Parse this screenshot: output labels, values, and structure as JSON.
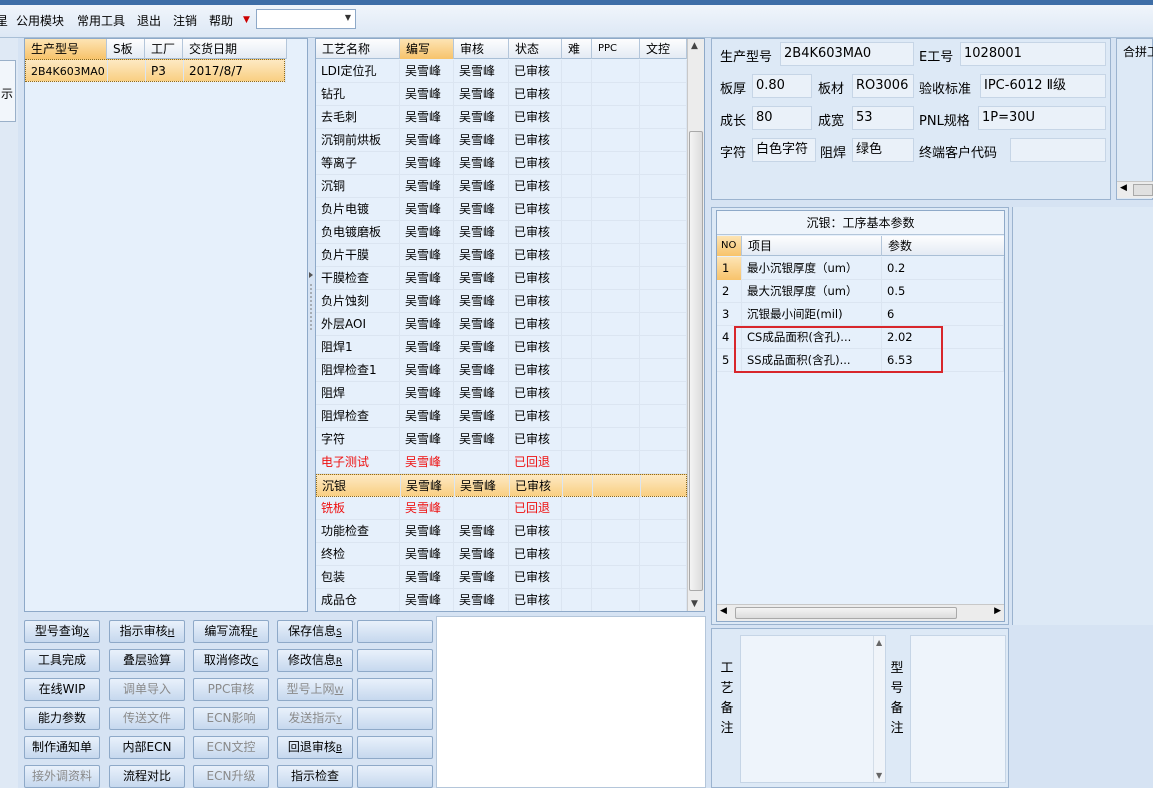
{
  "menu": {
    "items": [
      "星",
      "公用模块",
      "常用工具",
      "退出",
      "注销",
      "帮助"
    ],
    "dropdown_value": ""
  },
  "left_strip": {
    "label": "示"
  },
  "model_grid": {
    "headers": [
      "生产型号",
      "S板",
      "工厂",
      "交货日期"
    ],
    "rows": [
      {
        "model": "2B4K603MA0",
        "s": "",
        "factory": "P3",
        "date": "2017/8/7"
      }
    ]
  },
  "process_grid": {
    "headers": [
      "工艺名称",
      "编写",
      "审核",
      "状态",
      "难",
      "PPC",
      "文控"
    ],
    "rows": [
      {
        "name": "LDI定位孔",
        "writer": "吴雪峰",
        "reviewer": "吴雪峰",
        "status": "已审核",
        "flag": "normal"
      },
      {
        "name": "钻孔",
        "writer": "吴雪峰",
        "reviewer": "吴雪峰",
        "status": "已审核",
        "flag": "normal"
      },
      {
        "name": "去毛刺",
        "writer": "吴雪峰",
        "reviewer": "吴雪峰",
        "status": "已审核",
        "flag": "normal"
      },
      {
        "name": "沉铜前烘板",
        "writer": "吴雪峰",
        "reviewer": "吴雪峰",
        "status": "已审核",
        "flag": "normal"
      },
      {
        "name": "等离子",
        "writer": "吴雪峰",
        "reviewer": "吴雪峰",
        "status": "已审核",
        "flag": "normal"
      },
      {
        "name": "沉铜",
        "writer": "吴雪峰",
        "reviewer": "吴雪峰",
        "status": "已审核",
        "flag": "normal"
      },
      {
        "name": "负片电镀",
        "writer": "吴雪峰",
        "reviewer": "吴雪峰",
        "status": "已审核",
        "flag": "normal"
      },
      {
        "name": "负电镀磨板",
        "writer": "吴雪峰",
        "reviewer": "吴雪峰",
        "status": "已审核",
        "flag": "normal"
      },
      {
        "name": "负片干膜",
        "writer": "吴雪峰",
        "reviewer": "吴雪峰",
        "status": "已审核",
        "flag": "normal"
      },
      {
        "name": "干膜检查",
        "writer": "吴雪峰",
        "reviewer": "吴雪峰",
        "status": "已审核",
        "flag": "normal"
      },
      {
        "name": "负片蚀刻",
        "writer": "吴雪峰",
        "reviewer": "吴雪峰",
        "status": "已审核",
        "flag": "normal"
      },
      {
        "name": "外层AOI",
        "writer": "吴雪峰",
        "reviewer": "吴雪峰",
        "status": "已审核",
        "flag": "normal"
      },
      {
        "name": "阻焊1",
        "writer": "吴雪峰",
        "reviewer": "吴雪峰",
        "status": "已审核",
        "flag": "normal"
      },
      {
        "name": "阻焊检查1",
        "writer": "吴雪峰",
        "reviewer": "吴雪峰",
        "status": "已审核",
        "flag": "normal"
      },
      {
        "name": "阻焊",
        "writer": "吴雪峰",
        "reviewer": "吴雪峰",
        "status": "已审核",
        "flag": "normal"
      },
      {
        "name": "阻焊检查",
        "writer": "吴雪峰",
        "reviewer": "吴雪峰",
        "status": "已审核",
        "flag": "normal"
      },
      {
        "name": "字符",
        "writer": "吴雪峰",
        "reviewer": "吴雪峰",
        "status": "已审核",
        "flag": "normal"
      },
      {
        "name": "电子测试",
        "writer": "吴雪峰",
        "reviewer": "",
        "status": "已回退",
        "flag": "returned"
      },
      {
        "name": "沉银",
        "writer": "吴雪峰",
        "reviewer": "吴雪峰",
        "status": "已审核",
        "flag": "selected"
      },
      {
        "name": "铣板",
        "writer": "吴雪峰",
        "reviewer": "",
        "status": "已回退",
        "flag": "returned"
      },
      {
        "name": "功能检查",
        "writer": "吴雪峰",
        "reviewer": "吴雪峰",
        "status": "已审核",
        "flag": "normal"
      },
      {
        "name": "终检",
        "writer": "吴雪峰",
        "reviewer": "吴雪峰",
        "status": "已审核",
        "flag": "normal"
      },
      {
        "name": "包装",
        "writer": "吴雪峰",
        "reviewer": "吴雪峰",
        "status": "已审核",
        "flag": "normal"
      },
      {
        "name": "成品仓",
        "writer": "吴雪峰",
        "reviewer": "吴雪峰",
        "status": "已审核",
        "flag": "normal"
      }
    ]
  },
  "info": {
    "model_label": "生产型号",
    "model_value": "2B4K603MA0",
    "eno_label": "E工号",
    "eno_value": "1028001",
    "thickness_label": "板厚",
    "thickness_value": "0.80",
    "material_label": "板材",
    "material_value": "RO3006",
    "standard_label": "验收标准",
    "standard_value": "IPC-6012 Ⅱ级",
    "length_label": "成长",
    "length_value": "80",
    "width_label": "成宽",
    "width_value": "53",
    "pnl_label": "PNL规格",
    "pnl_value": "1P=30U",
    "legend_label": "字符",
    "legend_value": "白色字符",
    "mask_label": "阻焊",
    "mask_value": "绿色",
    "customer_label": "终端客户代码",
    "customer_value": ""
  },
  "merge_panel": {
    "title": "合拼工"
  },
  "params": {
    "title": "沉银：工序基本参数",
    "headers": [
      "NO",
      "项目",
      "参数"
    ],
    "rows": [
      {
        "no": "1",
        "item": "最小沉银厚度（um）",
        "value": "0.2"
      },
      {
        "no": "2",
        "item": "最大沉银厚度（um）",
        "value": "0.5"
      },
      {
        "no": "3",
        "item": "沉银最小间距(mil)",
        "value": "6"
      },
      {
        "no": "4",
        "item": "CS成品面积(含孔)...",
        "value": "2.02"
      },
      {
        "no": "5",
        "item": "SS成品面积(含孔)...",
        "value": "6.53"
      }
    ]
  },
  "remarks": {
    "process_label": "工艺备注",
    "model_label": "型号备注"
  },
  "buttons": [
    [
      {
        "label": "型号查询",
        "key": "X",
        "enabled": true
      },
      {
        "label": "指示审核",
        "key": "H",
        "enabled": true
      },
      {
        "label": "编写流程",
        "key": "F",
        "enabled": true
      },
      {
        "label": "保存信息",
        "key": "S",
        "enabled": true
      },
      {
        "label": "",
        "key": "",
        "enabled": true
      }
    ],
    [
      {
        "label": "工具完成",
        "key": "",
        "enabled": true
      },
      {
        "label": "叠层验算",
        "key": "",
        "enabled": true
      },
      {
        "label": "取消修改",
        "key": "C",
        "enabled": true
      },
      {
        "label": "修改信息",
        "key": "R",
        "enabled": true
      },
      {
        "label": "",
        "key": "",
        "enabled": true
      }
    ],
    [
      {
        "label": "在线WIP",
        "key": "",
        "enabled": true
      },
      {
        "label": "调单导入",
        "key": "",
        "enabled": false
      },
      {
        "label": "PPC审核",
        "key": "",
        "enabled": false
      },
      {
        "label": "型号上网",
        "key": "W",
        "enabled": false
      },
      {
        "label": "",
        "key": "",
        "enabled": true
      }
    ],
    [
      {
        "label": "能力参数",
        "key": "",
        "enabled": true
      },
      {
        "label": "传送文件",
        "key": "",
        "enabled": false
      },
      {
        "label": "ECN影响",
        "key": "",
        "enabled": false
      },
      {
        "label": "发送指示",
        "key": "Y",
        "enabled": false
      },
      {
        "label": "",
        "key": "",
        "enabled": true
      }
    ],
    [
      {
        "label": "制作通知单",
        "key": "",
        "enabled": true
      },
      {
        "label": "内部ECN",
        "key": "",
        "enabled": true
      },
      {
        "label": "ECN文控",
        "key": "",
        "enabled": false
      },
      {
        "label": "回退审核",
        "key": "B",
        "enabled": true
      },
      {
        "label": "",
        "key": "",
        "enabled": true
      }
    ],
    [
      {
        "label": "接外调资料",
        "key": "",
        "enabled": false
      },
      {
        "label": "流程对比",
        "key": "",
        "enabled": true
      },
      {
        "label": "ECN升级",
        "key": "",
        "enabled": false
      },
      {
        "label": "指示检查",
        "key": "",
        "enabled": true
      },
      {
        "label": "",
        "key": "",
        "enabled": true
      }
    ]
  ]
}
